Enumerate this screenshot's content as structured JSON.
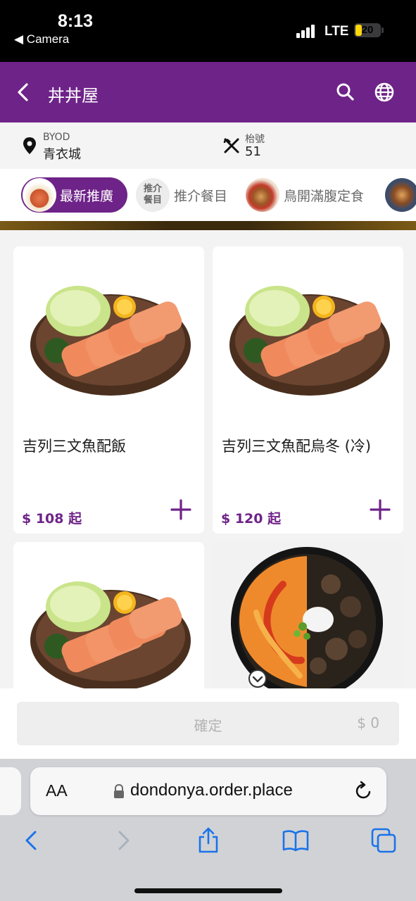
{
  "status_bar": {
    "time": "8:13",
    "back_label": "◀ Camera",
    "network": "LTE",
    "battery": "20",
    "battery_level": 0.2
  },
  "header": {
    "title": "丼丼屋"
  },
  "info": {
    "location_small": "BYOD",
    "location": "青衣城",
    "table_small": "枱號",
    "table": "51"
  },
  "categories": [
    {
      "label": "最新推廣",
      "active": true
    },
    {
      "label": "推介餐目",
      "thumb_text": "推介\n餐目"
    },
    {
      "label": "鳥開滿腹定食"
    }
  ],
  "products": [
    {
      "name": "吉列三文魚配飯",
      "price": "$ 108 起"
    },
    {
      "name": "吉列三文魚配烏冬 (冷)",
      "price": "$ 120 起"
    },
    {
      "name": "",
      "price": ""
    },
    {
      "name": "",
      "price": ""
    }
  ],
  "confirm": {
    "label": "確定",
    "total": "$ 0"
  },
  "browser": {
    "aa": "AA",
    "url": "dondonya.order.place"
  },
  "colors": {
    "brand": "#6e2388",
    "status_bar": "#000000",
    "battery": "#ffd60a"
  },
  "icons": [
    "back-icon",
    "search-icon",
    "globe-icon",
    "location-pin-icon",
    "utensils-icon",
    "plus-icon",
    "lock-icon",
    "reload-icon",
    "browser-back-icon",
    "browser-forward-icon",
    "share-icon",
    "bookmarks-icon",
    "tabs-icon"
  ]
}
